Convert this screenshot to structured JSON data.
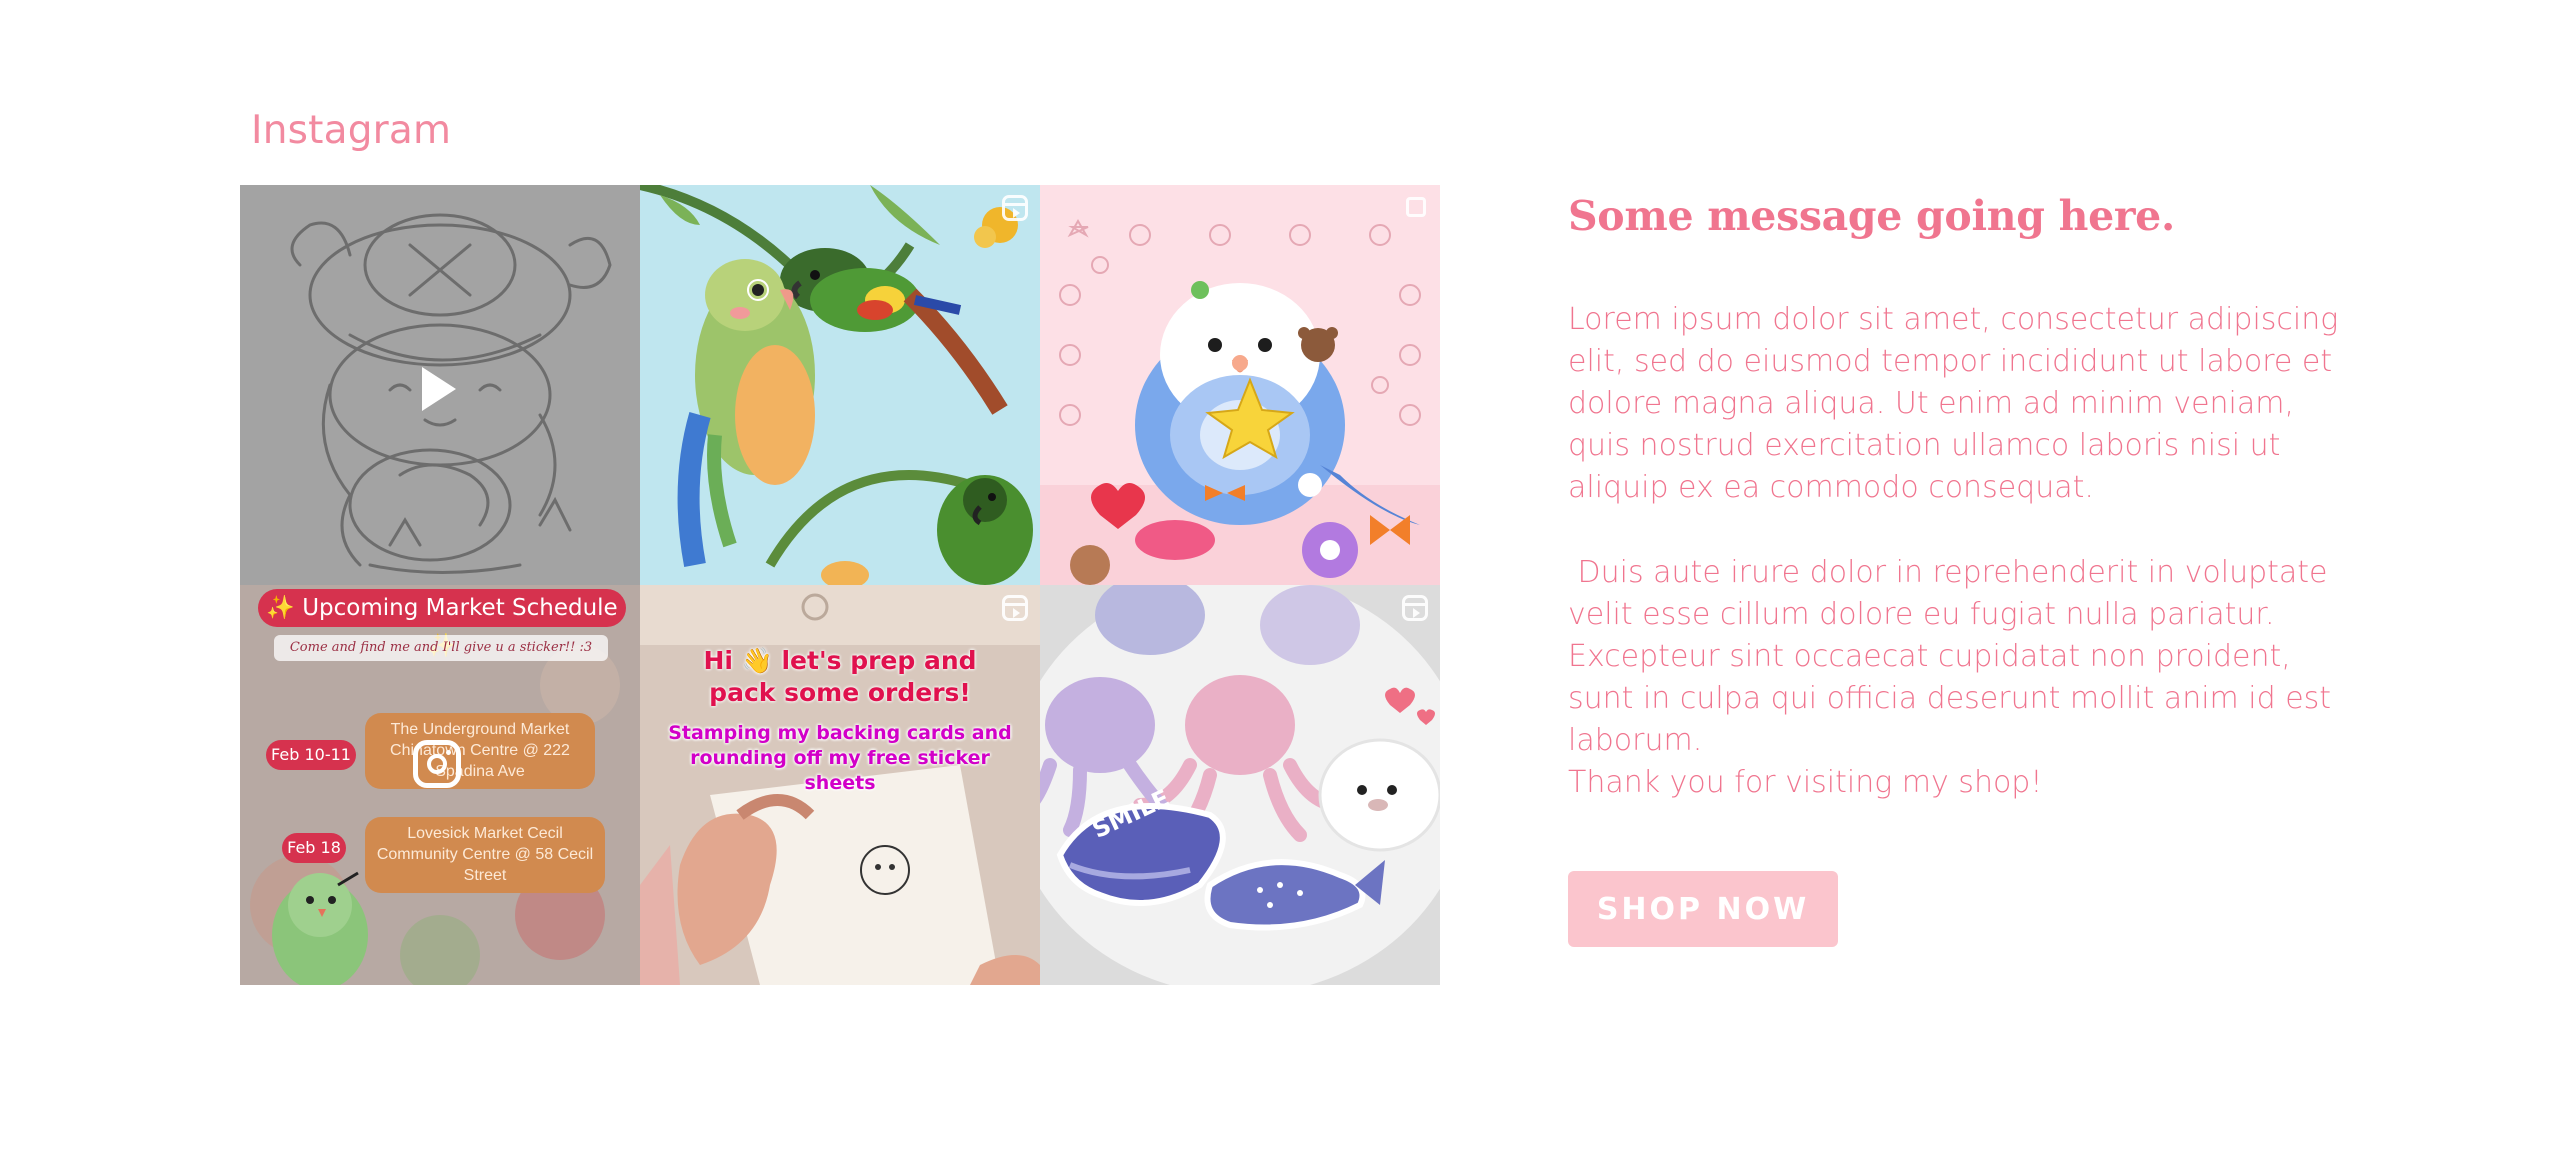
{
  "instagram": {
    "heading": "Instagram",
    "tiles": [
      {
        "kind": "video",
        "icon": "play-icon"
      },
      {
        "kind": "reel",
        "icon": "reel-icon"
      },
      {
        "kind": "carousel",
        "icon": "multiple-posts-icon"
      },
      {
        "kind": "carousel",
        "icon": "instagram-icon",
        "banner": "✨ Upcoming Market Schedule ✨",
        "subtitle": "Come and find me and I'll give u a sticker!! :3",
        "events": [
          {
            "date": "Feb 10-11",
            "place": "The Underground Market Chinatown Centre @ 222 Spadina Ave"
          },
          {
            "date": "Feb 18",
            "place": "Lovesick Market Cecil Community Centre @ 58 Cecil Street"
          }
        ]
      },
      {
        "kind": "reel",
        "icon": "reel-icon",
        "title": "Hi 👋 let's prep and pack some orders!",
        "subtitle": "Stamping my backing cards and rounding off my free sticker sheets"
      },
      {
        "kind": "reel",
        "icon": "reel-icon",
        "sticker_text": "SMILE"
      }
    ]
  },
  "message": {
    "title": "Some message going here.",
    "paragraph1": "Lorem ipsum dolor sit amet, consectetur adipiscing elit, sed do eiusmod tempor incididunt ut labore et dolore magna aliqua. Ut enim ad minim veniam, quis nostrud exercitation ullamco laboris nisi ut aliquip ex ea commodo consequat.",
    "paragraph2": " Duis aute irure dolor in reprehenderit in voluptate velit esse cillum dolore eu fugiat nulla pariatur. Excepteur sint occaecat cupidatat non proident, sunt in culpa qui officia deserunt mollit anim id est laborum.",
    "paragraph3": "Thank you for visiting my shop!",
    "button_label": "SHOP NOW"
  },
  "colors": {
    "accent_text": "#f0758f",
    "button_bg": "#fbc5cd",
    "button_text": "#ffffff"
  }
}
